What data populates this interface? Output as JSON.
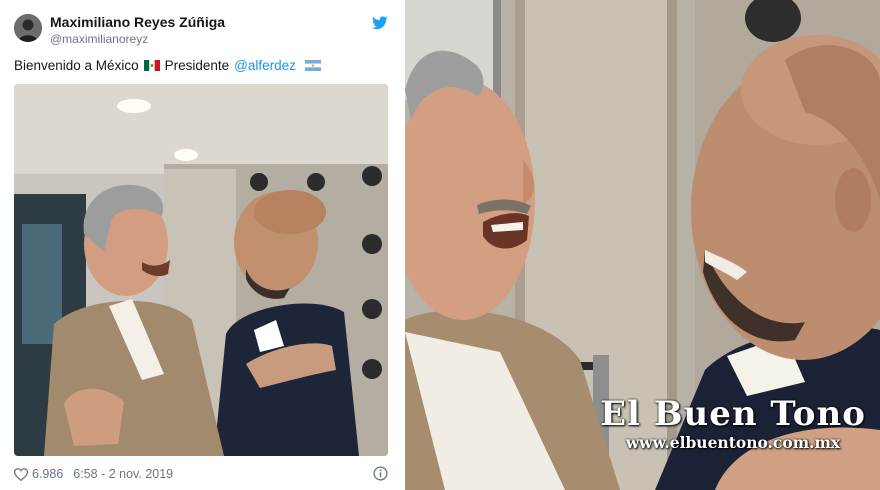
{
  "tweet": {
    "author_name": "Maximiliano Reyes Zúñiga",
    "author_handle": "@maximilianoreyz",
    "text_before": "Bienvenido a México",
    "text_middle": "Presidente",
    "mention": "@alferdez",
    "likes": "6.986",
    "timestamp": "6:58 - 2 nov. 2019",
    "link_color": "#1b95e0",
    "brand_color": "#1da1f2",
    "icons": [
      "twitter-bird-icon",
      "mexico-flag-icon",
      "argentina-flag-icon",
      "heart-icon",
      "info-icon"
    ]
  },
  "watermark": {
    "title": "El Buen Tono",
    "url": "www.elbuentono.com.mx"
  }
}
